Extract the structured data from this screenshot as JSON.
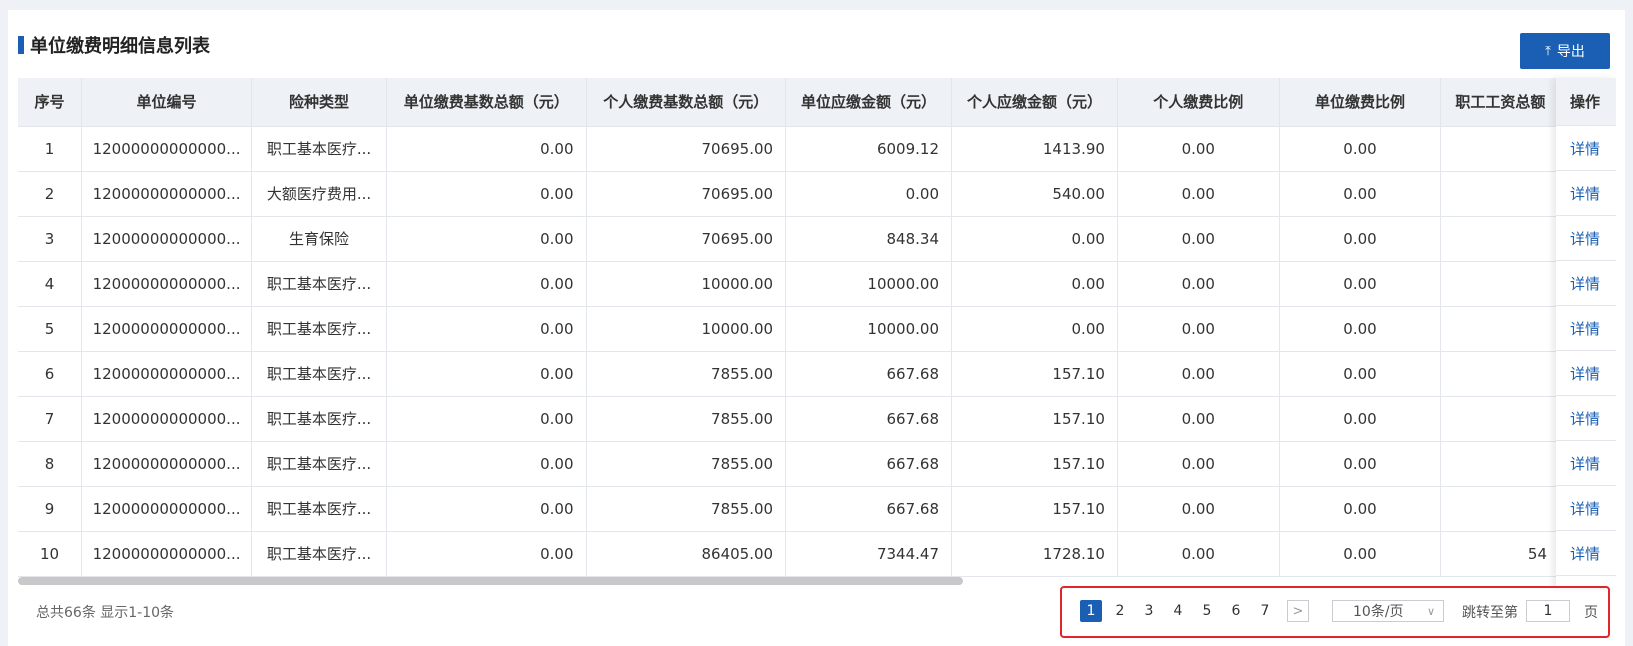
{
  "title": "单位缴费明细信息列表",
  "export_label": "导出",
  "columns": [
    "序号",
    "单位编号",
    "险种类型",
    "单位缴费基数总额（元）",
    "个人缴费基数总额（元）",
    "单位应缴金额（元）",
    "个人应缴金额（元）",
    "个人缴费比例",
    "单位缴费比例",
    "职工工资总额"
  ],
  "operation_header": "操作",
  "detail_label": "详情",
  "rows": [
    {
      "no": "1",
      "unit": "12000000000000...",
      "type": "职工基本医疗...",
      "unit_base": "0.00",
      "person_base": "70695.00",
      "unit_due": "6009.12",
      "person_due": "1413.90",
      "person_ratio": "0.00",
      "unit_ratio": "0.00",
      "wage": ""
    },
    {
      "no": "2",
      "unit": "12000000000000...",
      "type": "大额医疗费用...",
      "unit_base": "0.00",
      "person_base": "70695.00",
      "unit_due": "0.00",
      "person_due": "540.00",
      "person_ratio": "0.00",
      "unit_ratio": "0.00",
      "wage": ""
    },
    {
      "no": "3",
      "unit": "12000000000000...",
      "type": "生育保险",
      "unit_base": "0.00",
      "person_base": "70695.00",
      "unit_due": "848.34",
      "person_due": "0.00",
      "person_ratio": "0.00",
      "unit_ratio": "0.00",
      "wage": ""
    },
    {
      "no": "4",
      "unit": "12000000000000...",
      "type": "职工基本医疗...",
      "unit_base": "0.00",
      "person_base": "10000.00",
      "unit_due": "10000.00",
      "person_due": "0.00",
      "person_ratio": "0.00",
      "unit_ratio": "0.00",
      "wage": ""
    },
    {
      "no": "5",
      "unit": "12000000000000...",
      "type": "职工基本医疗...",
      "unit_base": "0.00",
      "person_base": "10000.00",
      "unit_due": "10000.00",
      "person_due": "0.00",
      "person_ratio": "0.00",
      "unit_ratio": "0.00",
      "wage": ""
    },
    {
      "no": "6",
      "unit": "12000000000000...",
      "type": "职工基本医疗...",
      "unit_base": "0.00",
      "person_base": "7855.00",
      "unit_due": "667.68",
      "person_due": "157.10",
      "person_ratio": "0.00",
      "unit_ratio": "0.00",
      "wage": ""
    },
    {
      "no": "7",
      "unit": "12000000000000...",
      "type": "职工基本医疗...",
      "unit_base": "0.00",
      "person_base": "7855.00",
      "unit_due": "667.68",
      "person_due": "157.10",
      "person_ratio": "0.00",
      "unit_ratio": "0.00",
      "wage": ""
    },
    {
      "no": "8",
      "unit": "12000000000000...",
      "type": "职工基本医疗...",
      "unit_base": "0.00",
      "person_base": "7855.00",
      "unit_due": "667.68",
      "person_due": "157.10",
      "person_ratio": "0.00",
      "unit_ratio": "0.00",
      "wage": ""
    },
    {
      "no": "9",
      "unit": "12000000000000...",
      "type": "职工基本医疗...",
      "unit_base": "0.00",
      "person_base": "7855.00",
      "unit_due": "667.68",
      "person_due": "157.10",
      "person_ratio": "0.00",
      "unit_ratio": "0.00",
      "wage": ""
    },
    {
      "no": "10",
      "unit": "12000000000000...",
      "type": "职工基本医疗...",
      "unit_base": "0.00",
      "person_base": "86405.00",
      "unit_due": "7344.47",
      "person_due": "1728.10",
      "person_ratio": "0.00",
      "unit_ratio": "0.00",
      "wage": "54"
    }
  ],
  "summary": "总共66条 显示1-10条",
  "pagination": {
    "pages": [
      "1",
      "2",
      "3",
      "4",
      "5",
      "6",
      "7"
    ],
    "current": "1",
    "next_icon": "chevron-right-icon",
    "page_size": "10条/页",
    "jump_label": "跳转至第",
    "jump_value": "1",
    "jump_suffix": "页"
  },
  "colors": {
    "accent": "#1a5fb4",
    "highlight_border": "#e0262a",
    "header_bg": "#eef1f6"
  }
}
